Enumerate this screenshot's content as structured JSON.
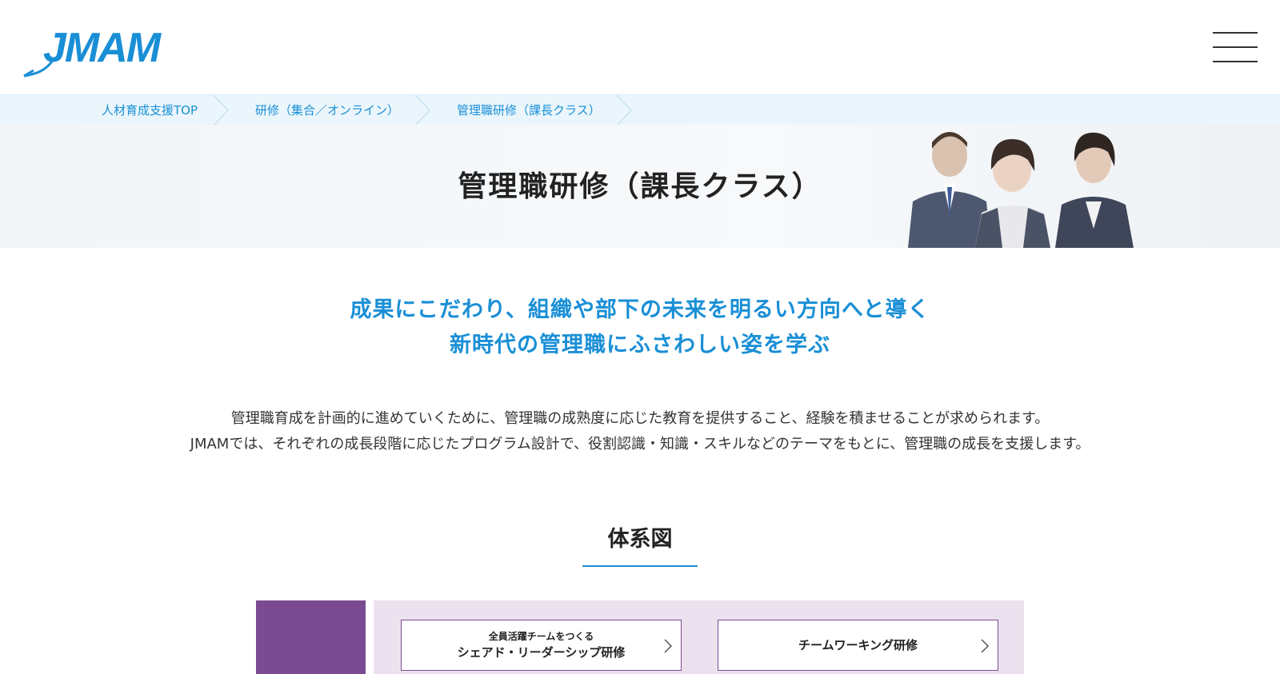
{
  "header": {
    "logo_text": "JMAM",
    "menu_icon": "hamburger-icon"
  },
  "breadcrumb": {
    "items": [
      {
        "label": "人材育成支援TOP"
      },
      {
        "label": "研修（集合／オンライン）"
      },
      {
        "label": "管理職研修（課長クラス）"
      }
    ]
  },
  "hero": {
    "title": "管理職研修（課長クラス）"
  },
  "lead": {
    "line1": "成果にこだわり、組織や部下の未来を明るい方向へと導く",
    "line2": "新時代の管理職にふさわしい姿を学ぶ"
  },
  "description": {
    "line1": "管理職育成を計画的に進めていくために、管理職の成熟度に応じた教育を提供すること、経験を積ませることが求められます。",
    "line2": "JMAMでは、それぞれの成長段階に応じたプログラム設計で、役割認識・知識・スキルなどのテーマをもとに、管理職の成長を支援します。"
  },
  "section": {
    "title": "体系図"
  },
  "diagram": {
    "courses": [
      {
        "sub": "全員活躍チームをつくる",
        "main": "シェアド・リーダーシップ研修"
      },
      {
        "sub": "",
        "main": "チームワーキング研修"
      }
    ]
  },
  "colors": {
    "brand_blue": "#1a8fd6",
    "purple": "#7a4a92",
    "light_purple": "#ece2ef",
    "breadcrumb_bg": "#eaf6fc"
  }
}
